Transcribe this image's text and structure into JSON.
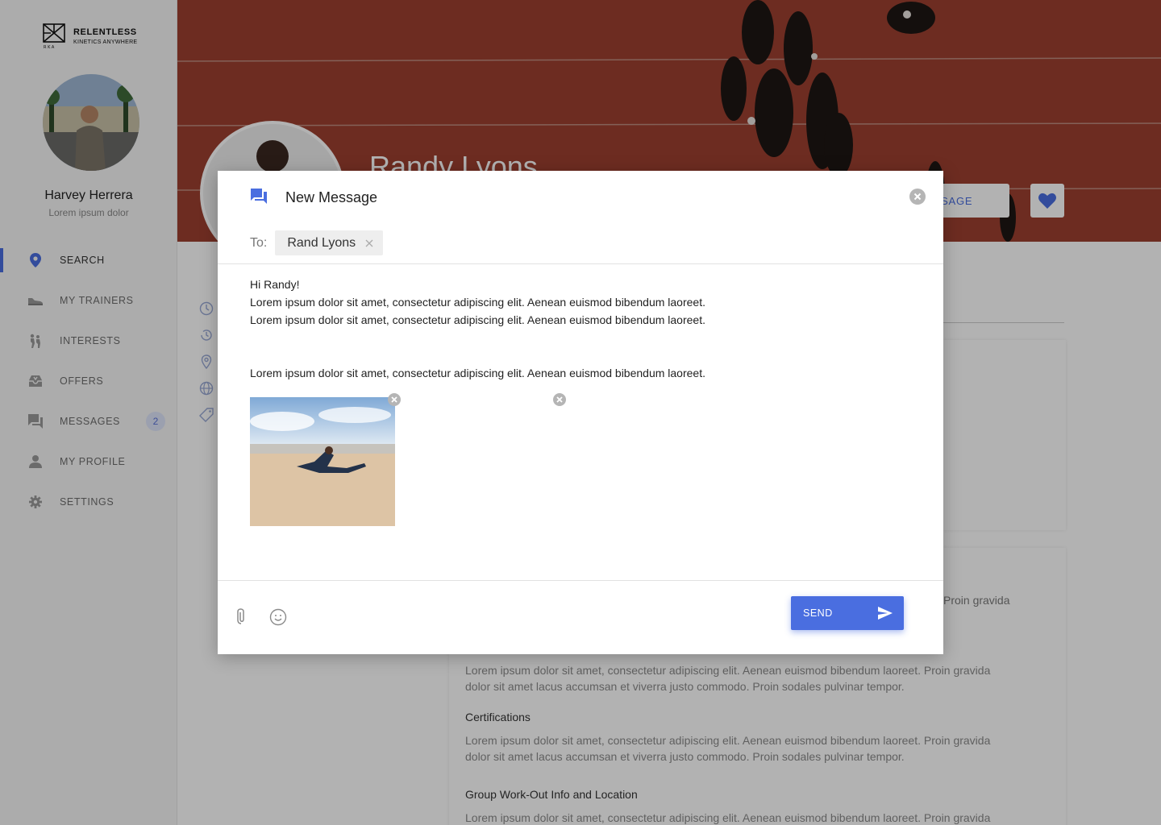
{
  "brand": {
    "name": "RELENTLESS",
    "tagline": "KINETICS ANYWHERE"
  },
  "user": {
    "name": "Harvey Herrera",
    "subtitle": "Lorem ipsum dolor"
  },
  "nav": {
    "items": [
      {
        "label": "SEARCH",
        "icon": "location-pin-icon",
        "active": true
      },
      {
        "label": "MY TRAINERS",
        "icon": "shoe-icon"
      },
      {
        "label": "INTERESTS",
        "icon": "running-people-icon"
      },
      {
        "label": "OFFERS",
        "icon": "inbox-tray-icon"
      },
      {
        "label": "MESSAGES",
        "icon": "chat-bubbles-icon",
        "badge": "2"
      },
      {
        "label": "MY PROFILE",
        "icon": "person-icon"
      },
      {
        "label": "SETTINGS",
        "icon": "gear-icon"
      }
    ]
  },
  "profile": {
    "name": "Randy Lyons",
    "message_button": "SSAGE",
    "peek_text": "Proin gravida",
    "sections": [
      {
        "text1": "Lorem ipsum dolor sit amet, consectetur adipiscing elit. Aenean euismod bibendum laoreet. Proin gravida",
        "text2": "dolor sit amet lacus accumsan et viverra justo commodo. Proin sodales pulvinar tempor."
      },
      {
        "heading": "Certifications",
        "text1": "Lorem ipsum dolor sit amet, consectetur adipiscing elit. Aenean euismod bibendum laoreet. Proin gravida",
        "text2": "dolor sit amet lacus accumsan et viverra justo commodo. Proin sodales pulvinar tempor."
      },
      {
        "heading": "Group Work-Out Info and Location",
        "text1": "Lorem ipsum dolor sit amet, consectetur adipiscing elit. Aenean euismod bibendum laoreet. Proin gravida"
      }
    ]
  },
  "modal": {
    "title": "New Message",
    "to_label": "To:",
    "recipient": "Rand Lyons",
    "body": {
      "greeting": "Hi  Randy!",
      "line1": "Lorem ipsum dolor sit amet, consectetur adipiscing elit. Aenean euismod bibendum laoreet.",
      "line2": "Lorem ipsum dolor sit amet, consectetur adipiscing elit. Aenean euismod bibendum laoreet.",
      "line3": "Lorem ipsum dolor sit amet, consectetur adipiscing elit. Aenean euismod bibendum laoreet."
    },
    "send_label": "SEND"
  },
  "colors": {
    "accent": "#4a6ee0",
    "hero": "#9c4030",
    "badge_bg": "#dfe5fb"
  }
}
